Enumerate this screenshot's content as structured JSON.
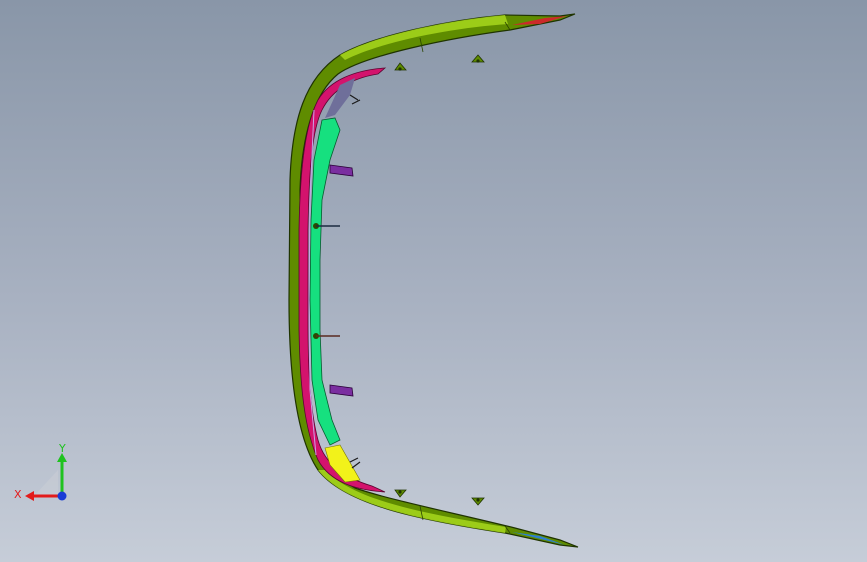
{
  "viewport": {
    "background_top": "#8996a8",
    "background_bottom": "#c6cdd8"
  },
  "model": {
    "outer_shell_color": "#5f8c00",
    "shell_highlight_color": "#a7d71c",
    "inner_trim_color": "#d3136d",
    "bracket_color": "#16e07f",
    "clip_color": "#7a2ea0",
    "upper_insert_color": "#6f6f9a",
    "lower_insert_color": "#f2f21a",
    "upper_tip_color": "#cc2a2a",
    "lower_tip_color": "#2e7fd0"
  },
  "triad": {
    "x_label": "X",
    "y_label": "Y",
    "x_color": "#e31b1b",
    "y_color": "#1fc21f",
    "z_color": "#1a3cd6"
  }
}
